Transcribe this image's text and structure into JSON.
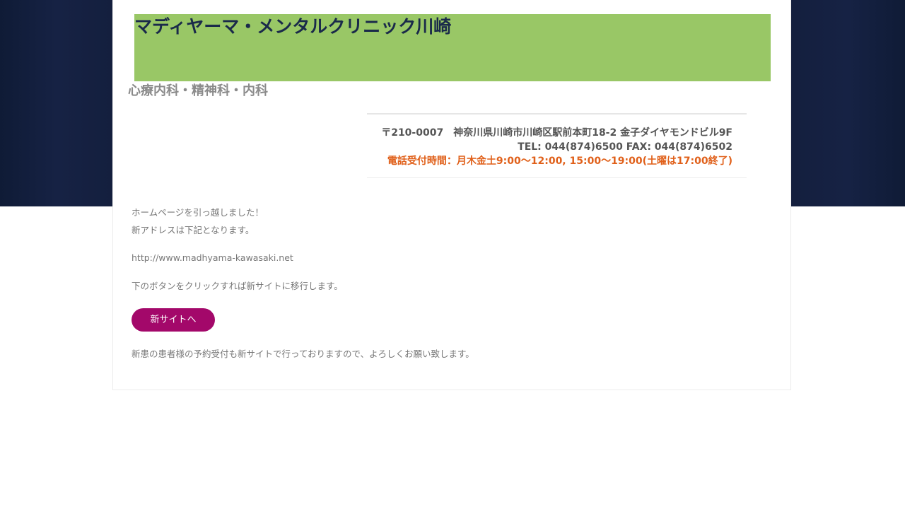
{
  "header": {
    "site_title": "マディヤーマ・メンタルクリニック川崎",
    "subtitle": "心療内科・精神科・内科",
    "accent_color": "#99c766"
  },
  "contact": {
    "address": "〒210-0007　神奈川県川崎市川崎区駅前本町18-2 金子ダイヤモンドビル9F",
    "tel_fax": "TEL: 044(874)6500 FAX: 044(874)6502",
    "hours": "電話受付時間：月木金土9:00〜12:00, 15:00〜19:00(土曜は17:00終了)"
  },
  "main": {
    "moved_notice": "ホームページを引っ越しました！",
    "new_address_intro": "新アドレスは下記となります。",
    "new_url": "http://www.madhyama-kawasaki.net",
    "click_instruction": "下のボタンをクリックすれば新サイトに移行します。",
    "new_site_button": "新サイトへ",
    "reservation_note": "新患の患者様の予約受付も新サイトで行っておりますので、よろしくお願い致します。",
    "button_color": "#a3086a"
  }
}
